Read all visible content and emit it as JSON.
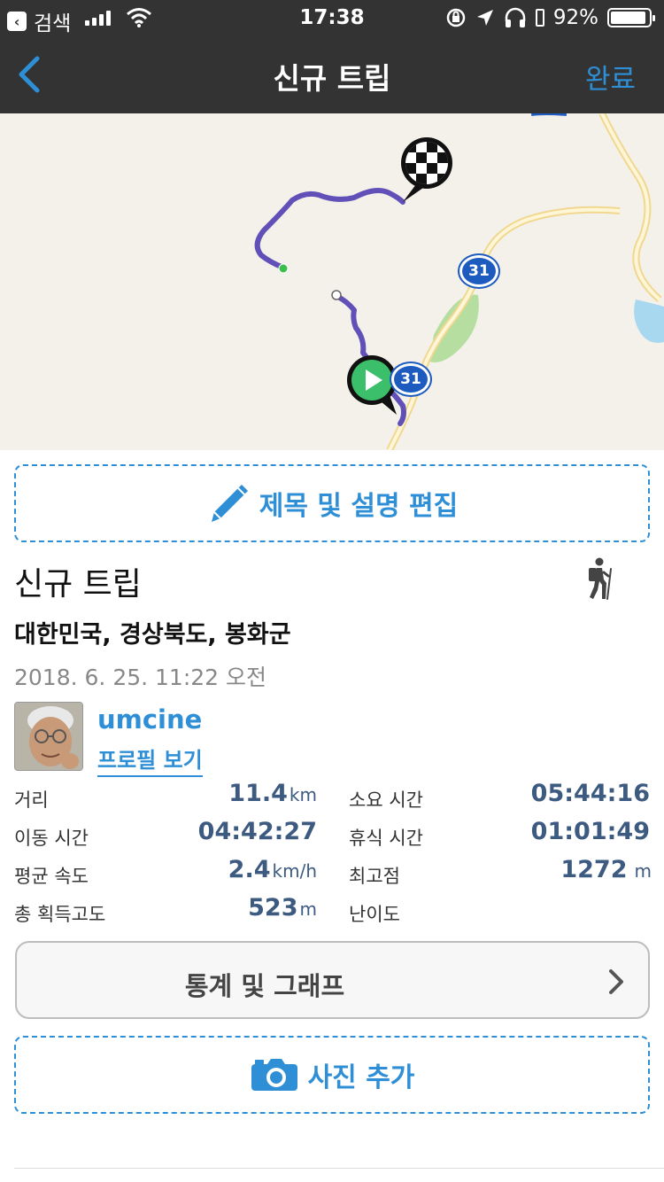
{
  "status_bar": {
    "back_app": "검색",
    "time": "17:38",
    "battery": "92%",
    "battery_level": 0.92
  },
  "nav": {
    "title": "신규 트립",
    "done": "완료"
  },
  "map": {
    "route_number": "31",
    "start_marker": "play-icon",
    "end_marker": "checkered-flag-icon"
  },
  "edit_button": {
    "label": "제목 및 설명 편집"
  },
  "trip": {
    "title": "신규 트립",
    "location": "대한민국, 경상북도, 봉화군",
    "date": "2018. 6. 25. 11:22 오전",
    "activity_icon": "hiker-icon"
  },
  "user": {
    "name": "umcine",
    "profile_link": "프로필 보기"
  },
  "stats": {
    "distance": {
      "label": "거리",
      "value": "11.4",
      "unit": "km"
    },
    "total_time": {
      "label": "소요 시간",
      "value": "05:44:16"
    },
    "moving_time": {
      "label": "이동 시간",
      "value": "04:42:27"
    },
    "rest_time": {
      "label": "휴식 시간",
      "value": "01:01:49"
    },
    "avg_speed": {
      "label": "평균 속도",
      "value": "2.4",
      "unit": "km/h"
    },
    "max_elevation": {
      "label": "최고점",
      "value": "1272",
      "unit": "m"
    },
    "elevation_gain": {
      "label": "총 획득고도",
      "value": "523",
      "unit": "m"
    },
    "difficulty": {
      "label": "난이도",
      "value": ""
    }
  },
  "stats_button": {
    "label": "통계 및 그래프"
  },
  "photo_button": {
    "label": "사진 추가"
  },
  "colors": {
    "accent": "#2f8fd6",
    "bar": "#333333",
    "route": "#6050b8",
    "stat_value": "#3d5a80"
  }
}
